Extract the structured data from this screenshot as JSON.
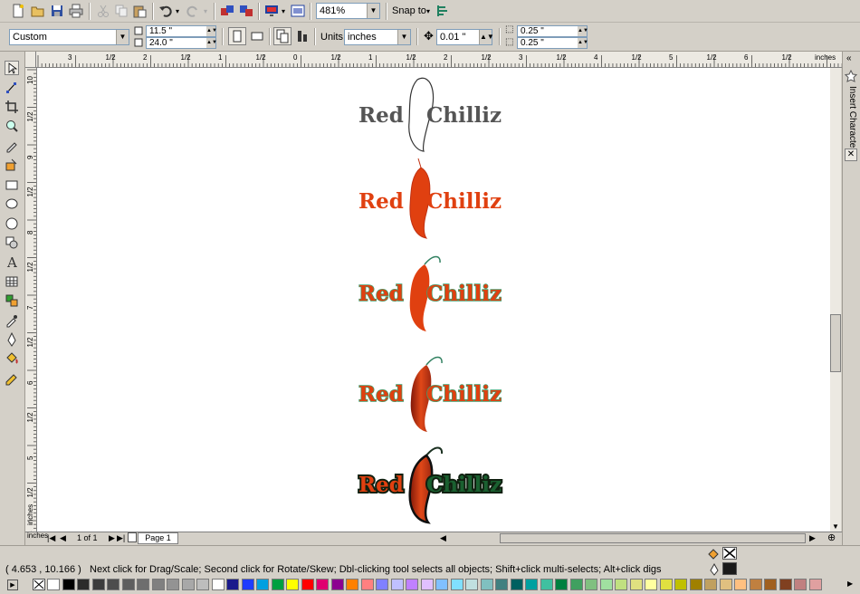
{
  "toolbar": {
    "zoom": "481%",
    "snap_to": "Snap to",
    "icons": [
      "new-icon",
      "open-icon",
      "save-icon",
      "print-icon",
      "cut-icon",
      "copy-icon",
      "paste-icon",
      "undo-icon",
      "redo-icon",
      "import-icon",
      "export-icon",
      "application-launcher-icon",
      "welcome-screen-icon",
      "options-icon"
    ]
  },
  "propertybar": {
    "paper_preset": "Custom",
    "width": "11.5 \"",
    "height": "24.0 \"",
    "units_label": "Units:",
    "units": "inches",
    "nudge": "0.01 \"",
    "dup_x": "0.25 \"",
    "dup_y": "0.25 \""
  },
  "tools": [
    "pick-tool-icon",
    "shape-tool-icon",
    "crop-tool-icon",
    "zoom-tool-icon",
    "freehand-tool-icon",
    "smart-fill-tool-icon",
    "rectangle-tool-icon",
    "ellipse-tool-icon",
    "polygon-tool-icon",
    "basic-shapes-tool-icon",
    "text-tool-icon",
    "table-tool-icon",
    "interactive-blend-tool-icon",
    "eyedropper-tool-icon",
    "outline-tool-icon",
    "fill-tool-icon",
    "interactive-fill-tool-icon"
  ],
  "ruler": {
    "h_labels": [
      "3",
      "1/2",
      "2",
      "1/2",
      "1",
      "1/2",
      "0",
      "1/2",
      "1",
      "1/2",
      "2",
      "1/2",
      "3",
      "1/2",
      "4",
      "1/2",
      "5",
      "1/2",
      "6",
      "1/2",
      "inches"
    ],
    "v_labels": [
      "10",
      "1/2",
      "9",
      "1/2",
      "8",
      "1/2",
      "7",
      "1/2",
      "6",
      "1/2",
      "5",
      "1/2",
      "4",
      "inches"
    ]
  },
  "logos": [
    {
      "variant": "outline",
      "left": "Red",
      "right": "Chilliz"
    },
    {
      "variant": "orange",
      "left": "Red",
      "right": "Chilliz"
    },
    {
      "variant": "green-outline",
      "left": "Red",
      "right": "Chilliz"
    },
    {
      "variant": "shaded",
      "left": "Red",
      "right": "Chilliz"
    },
    {
      "variant": "dark-outline",
      "left": "Red",
      "right": "Chilliz"
    }
  ],
  "docker": {
    "tab_label": "Insert Character"
  },
  "pagenav": {
    "page_count": "1 of 1",
    "page_tab": "Page 1"
  },
  "status": {
    "coords": "( 4.653 , 10.166 )",
    "message": "Next click for Drag/Scale; Second click for Rotate/Skew; Dbl-clicking tool selects all objects; Shift+click multi-selects; Alt+click digs"
  },
  "palette": {
    "colors": [
      "#ffffff",
      "#000000",
      "#2b2b2b",
      "#3c3c3c",
      "#4d4d4d",
      "#5e5e5e",
      "#6e6e6e",
      "#808080",
      "#939393",
      "#a8a8a8",
      "#bdbdbd",
      "#ffffff",
      "#1a1a8c",
      "#1e3cff",
      "#00a0e0",
      "#00a040",
      "#ffff00",
      "#ff0000",
      "#e00070",
      "#8c0090",
      "#ff8000",
      "#ff8080",
      "#8080ff",
      "#c0c0ff",
      "#c080ff",
      "#e0c0ff",
      "#80c0ff",
      "#80e0ff",
      "#c0e0e0",
      "#80c0c0",
      "#408080",
      "#006060",
      "#00a0a0",
      "#40c0a0",
      "#008040",
      "#40a060",
      "#80c080",
      "#a0e0a0",
      "#c0e080",
      "#e0e080",
      "#ffffa0",
      "#e0e040",
      "#c0c000",
      "#a08000",
      "#c0a060",
      "#e0c080",
      "#ffc080",
      "#c08040",
      "#a06020",
      "#804020",
      "#c08080",
      "#e0a0a0"
    ]
  }
}
